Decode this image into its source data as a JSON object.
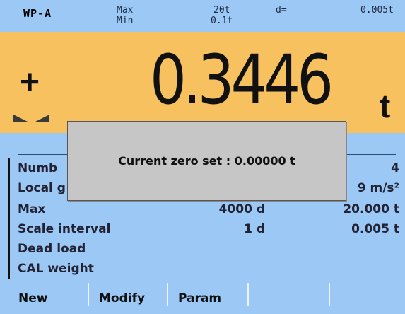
{
  "header": {
    "device_id": "WP-A",
    "max_label": "Max",
    "min_label": "Min",
    "max_value": "20t",
    "min_value": "0.1t",
    "d_label": "d=",
    "d_value": "0.005t"
  },
  "display": {
    "sign": "+",
    "reading": "0.3446",
    "unit": "t"
  },
  "table": {
    "rows": [
      {
        "label": "Numb",
        "v1": "",
        "v2": "4"
      },
      {
        "label": "Local g",
        "v1": "",
        "v2": "9 m/s²"
      },
      {
        "label": "Max",
        "v1": "4000 d",
        "v2": "20.000 t"
      },
      {
        "label": "Scale interval",
        "v1": "1 d",
        "v2": "0.005 t"
      },
      {
        "label": "Dead load",
        "v1": "",
        "v2": ""
      },
      {
        "label": "CAL weight",
        "v1": "",
        "v2": ""
      }
    ]
  },
  "dialog": {
    "message": "Current zero set : 0.00000 t"
  },
  "softkeys": [
    "New",
    "Modify",
    "Param",
    "",
    ""
  ],
  "colors": {
    "background": "#9cc8f5",
    "display": "#f8c15f",
    "dialog": "#c6c6c6"
  }
}
